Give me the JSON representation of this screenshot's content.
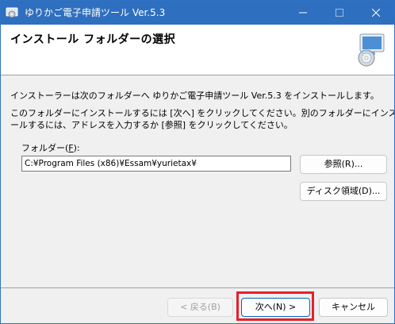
{
  "window": {
    "title": "ゆりかご電子申請ツール Ver.5.3",
    "icons": {
      "app": "installer-icon",
      "minimize": "minimize-icon",
      "maximize": "maximize-icon",
      "close": "close-icon"
    }
  },
  "header": {
    "title": "インストール フォルダーの選択",
    "icon": "computer-disk-icon"
  },
  "body": {
    "line1": "インストーラーは次のフォルダーへ ゆりかご電子申請ツール Ver.5.3 をインストールします。",
    "line2": "このフォルダーにインストールするには [次へ] をクリックしてください。別のフォルダーにインスト",
    "line3": "ールするには、アドレスを入力するか [参照] をクリックしてください。"
  },
  "folder": {
    "label_prefix": "フォルダー(",
    "label_key": "F",
    "label_suffix": "):",
    "value": "C:¥Program Files (x86)¥Essam¥yurietax¥",
    "browse_label": "参照(R)...",
    "disk_label": "ディスク領域(D)..."
  },
  "footer": {
    "back_label": "< 戻る(B)",
    "next_label": "次へ(N) >",
    "cancel_label": "キャンセル"
  },
  "colors": {
    "titlebar": "#2f6fbf",
    "highlight": "#e8202a",
    "default_button_border": "#0067c0"
  }
}
